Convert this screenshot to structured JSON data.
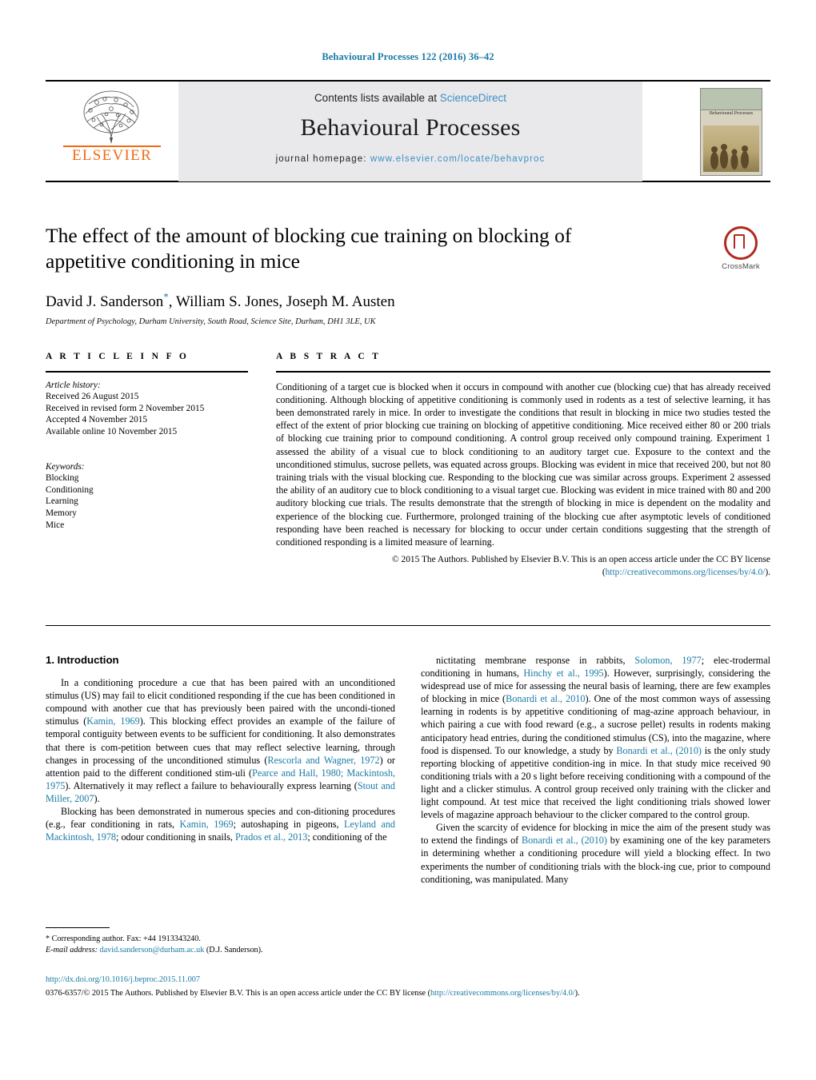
{
  "running_head": "Behavioural Processes 122 (2016) 36–42",
  "masthead": {
    "contents_prefix": "Contents lists available at ",
    "sciencedirect": "ScienceDirect",
    "journal_name": "Behavioural Processes",
    "homepage_prefix": "journal homepage: ",
    "homepage_url": "www.elsevier.com/locate/behavproc",
    "publisher_wordmark": "ELSEVIER",
    "cover_title": "Behavioural Processes",
    "accent_blue": "#3d8fc4",
    "elsevier_orange": "#f06a16"
  },
  "article": {
    "title": "The effect of the amount of blocking cue training on blocking of appetitive conditioning in mice",
    "authors": "David J. Sanderson, William S. Jones, Joseph M. Austen",
    "corresponding_marker": "*",
    "affiliation": "Department of Psychology, Durham University, South Road, Science Site, Durham, DH1 3LE, UK"
  },
  "crossmark": {
    "label": "CrossMark",
    "color": "#b02a1f"
  },
  "article_info": {
    "heading": "A R T I C L E   I N F O",
    "history_label": "Article history:",
    "history": [
      "Received 26 August 2015",
      "Received in revised form 2 November 2015",
      "Accepted 4 November 2015",
      "Available online 10 November 2015"
    ],
    "keywords_label": "Keywords:",
    "keywords": [
      "Blocking",
      "Conditioning",
      "Learning",
      "Memory",
      "Mice"
    ]
  },
  "abstract": {
    "heading": "A B S T R A C T",
    "text": "Conditioning of a target cue is blocked when it occurs in compound with another cue (blocking cue) that has already received conditioning. Although blocking of appetitive conditioning is commonly used in rodents as a test of selective learning, it has been demonstrated rarely in mice. In order to investigate the conditions that result in blocking in mice two studies tested the effect of the extent of prior blocking cue training on blocking of appetitive conditioning. Mice received either 80 or 200 trials of blocking cue training prior to compound conditioning. A control group received only compound training. Experiment 1 assessed the ability of a visual cue to block conditioning to an auditory target cue. Exposure to the context and the unconditioned stimulus, sucrose pellets, was equated across groups. Blocking was evident in mice that received 200, but not 80 training trials with the visual blocking cue. Responding to the blocking cue was similar across groups. Experiment 2 assessed the ability of an auditory cue to block conditioning to a visual target cue. Blocking was evident in mice trained with 80 and 200 auditory blocking cue trials. The results demonstrate that the strength of blocking in mice is dependent on the modality and experience of the blocking cue. Furthermore, prolonged training of the blocking cue after asymptotic levels of conditioned responding have been reached is necessary for blocking to occur under certain conditions suggesting that the strength of conditioned responding is a limited measure of learning.",
    "copyright_text": "© 2015 The Authors. Published by Elsevier B.V. This is an open access article under the CC BY license",
    "license_open": "(",
    "license_url": "http://creativecommons.org/licenses/by/4.0/",
    "license_close": ")."
  },
  "introduction": {
    "section_number_title": "1.  Introduction",
    "left_paragraphs": [
      {
        "runs": [
          {
            "t": "In a conditioning procedure a cue that has been paired with an unconditioned stimulus (US) may fail to elicit conditioned responding if the cue has been conditioned in compound with another cue that has previously been paired with the uncondi-tioned stimulus ("
          },
          {
            "t": "Kamin, 1969",
            "link": true
          },
          {
            "t": "). This blocking effect provides an example of the failure of temporal contiguity between events to be sufficient for conditioning. It also demonstrates that there is com-petition between cues that may reflect selective learning, through changes in processing of the unconditioned stimulus ("
          },
          {
            "t": "Rescorla and Wagner, 1972",
            "link": true
          },
          {
            "t": ") or attention paid to the different conditioned stim-uli ("
          },
          {
            "t": "Pearce and Hall, 1980; Mackintosh, 1975",
            "link": true
          },
          {
            "t": "). Alternatively it may reflect a failure to behaviourally express learning ("
          },
          {
            "t": "Stout and Miller, 2007",
            "link": true
          },
          {
            "t": ")."
          }
        ]
      },
      {
        "runs": [
          {
            "t": "Blocking has been demonstrated in numerous species and con-ditioning procedures (e.g., fear conditioning in rats, "
          },
          {
            "t": "Kamin, 1969",
            "link": true
          },
          {
            "t": "; autoshaping in pigeons, "
          },
          {
            "t": "Leyland and Mackintosh, 1978",
            "link": true
          },
          {
            "t": "; odour conditioning in snails, "
          },
          {
            "t": "Prados et al., 2013",
            "link": true
          },
          {
            "t": "; conditioning of the"
          }
        ]
      }
    ],
    "right_paragraphs": [
      {
        "runs": [
          {
            "t": "nictitating membrane response in rabbits, "
          },
          {
            "t": "Solomon, 1977",
            "link": true
          },
          {
            "t": "; elec-trodermal conditioning in humans, "
          },
          {
            "t": "Hinchy et al., 1995",
            "link": true
          },
          {
            "t": "). However, surprisingly, considering the widespread use of mice for assessing the neural basis of learning, there are few examples of blocking in mice ("
          },
          {
            "t": "Bonardi et al., 2010",
            "link": true
          },
          {
            "t": "). One of the most common ways of assessing learning in rodents is by appetitive conditioning of mag-azine approach behaviour, in which pairing a cue with food reward (e.g., a sucrose pellet) results in rodents making anticipatory head entries, during the conditioned stimulus (CS), into the magazine, where food is dispensed. To our knowledge, a study by "
          },
          {
            "t": "Bonardi et al., (2010)",
            "link": true
          },
          {
            "t": " is the only study reporting blocking of appetitive condition-ing in mice. In that study mice received 90 conditioning trials with a 20 s light before receiving conditioning with a compound of the light and a clicker stimulus. A control group received only training with the clicker and light compound. At test mice that received the light conditioning trials showed lower levels of magazine approach behaviour to the clicker compared to the control group."
          }
        ]
      },
      {
        "runs": [
          {
            "t": "Given the scarcity of evidence for blocking in mice the aim of the present study was to extend the findings of "
          },
          {
            "t": "Bonardi et al., (2010)",
            "link": true
          },
          {
            "t": " by examining one of the key parameters in determining whether a conditioning procedure will yield a blocking effect. In two experiments the number of conditioning trials with the block-ing cue, prior to compound conditioning, was manipulated. Many"
          }
        ]
      }
    ]
  },
  "footnote": {
    "corresponding": "* Corresponding author. Fax: +44 1913343240.",
    "email_label": "E-mail address:",
    "email": "david.sanderson@durham.ac.uk",
    "email_suffix": " (D.J. Sanderson)."
  },
  "footer": {
    "doi": "http://dx.doi.org/10.1016/j.beproc.2015.11.007",
    "issn_copyright": "0376-6357/© 2015 The Authors. Published by Elsevier B.V. This is an open access article under the CC BY license (",
    "license_url": "http://creativecommons.org/licenses/by/4.0/",
    "license_close": ")."
  }
}
